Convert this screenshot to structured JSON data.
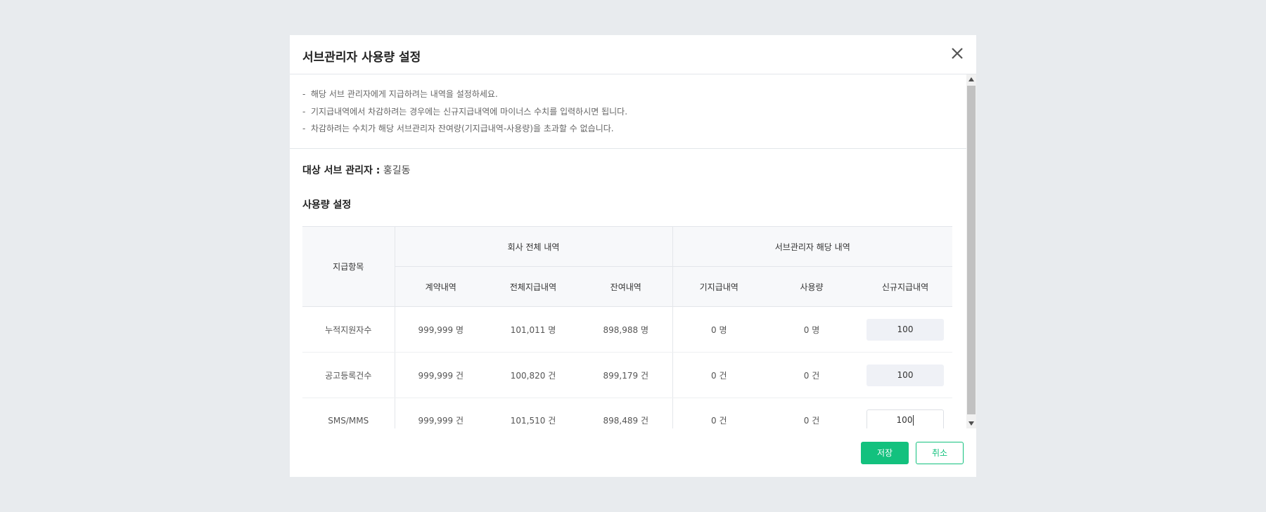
{
  "modal": {
    "title": "서브관리자 사용량 설정",
    "close_icon": "close-icon"
  },
  "notice": {
    "lines": [
      "해당 서브 관리자에게 지급하려는 내역을 설정하세요.",
      "기지급내역에서 차감하려는 경우에는 신규지급내역에 마이너스 수치를 입력하시면 됩니다.",
      "차감하려는 수치가 해당 서브관리자 잔여량(기지급내역-사용량)을 초과할 수 없습니다."
    ],
    "bullet": "-"
  },
  "target": {
    "label": "대상 서브 관리자 :",
    "value": "홍길동"
  },
  "section": {
    "title": "사용량 설정"
  },
  "table": {
    "item_header": "지급항목",
    "company_header": "회사 전체 내역",
    "sub_header": "서브관리자 해당 내역",
    "columns": [
      "계약내역",
      "전체지급내역",
      "잔여내역",
      "기지급내역",
      "사용량",
      "신규지급내역"
    ],
    "rows": [
      {
        "item": "누적지원자수",
        "contract": "999,999 명",
        "total_paid": "101,011 명",
        "remaining": "898,988 명",
        "paid": "0 명",
        "used": "0 명",
        "new_paid": "100"
      },
      {
        "item": "공고등록건수",
        "contract": "999,999 건",
        "total_paid": "100,820 건",
        "remaining": "899,179 건",
        "paid": "0 건",
        "used": "0 건",
        "new_paid": "100"
      },
      {
        "item": "SMS/MMS",
        "contract": "999,999 건",
        "total_paid": "101,510 건",
        "remaining": "898,489 건",
        "paid": "0 건",
        "used": "0 건",
        "new_paid": "100"
      }
    ]
  },
  "buttons": {
    "save": "저장",
    "cancel": "취소"
  },
  "colors": {
    "accent": "#13c17e",
    "background": "#e8ebee"
  }
}
